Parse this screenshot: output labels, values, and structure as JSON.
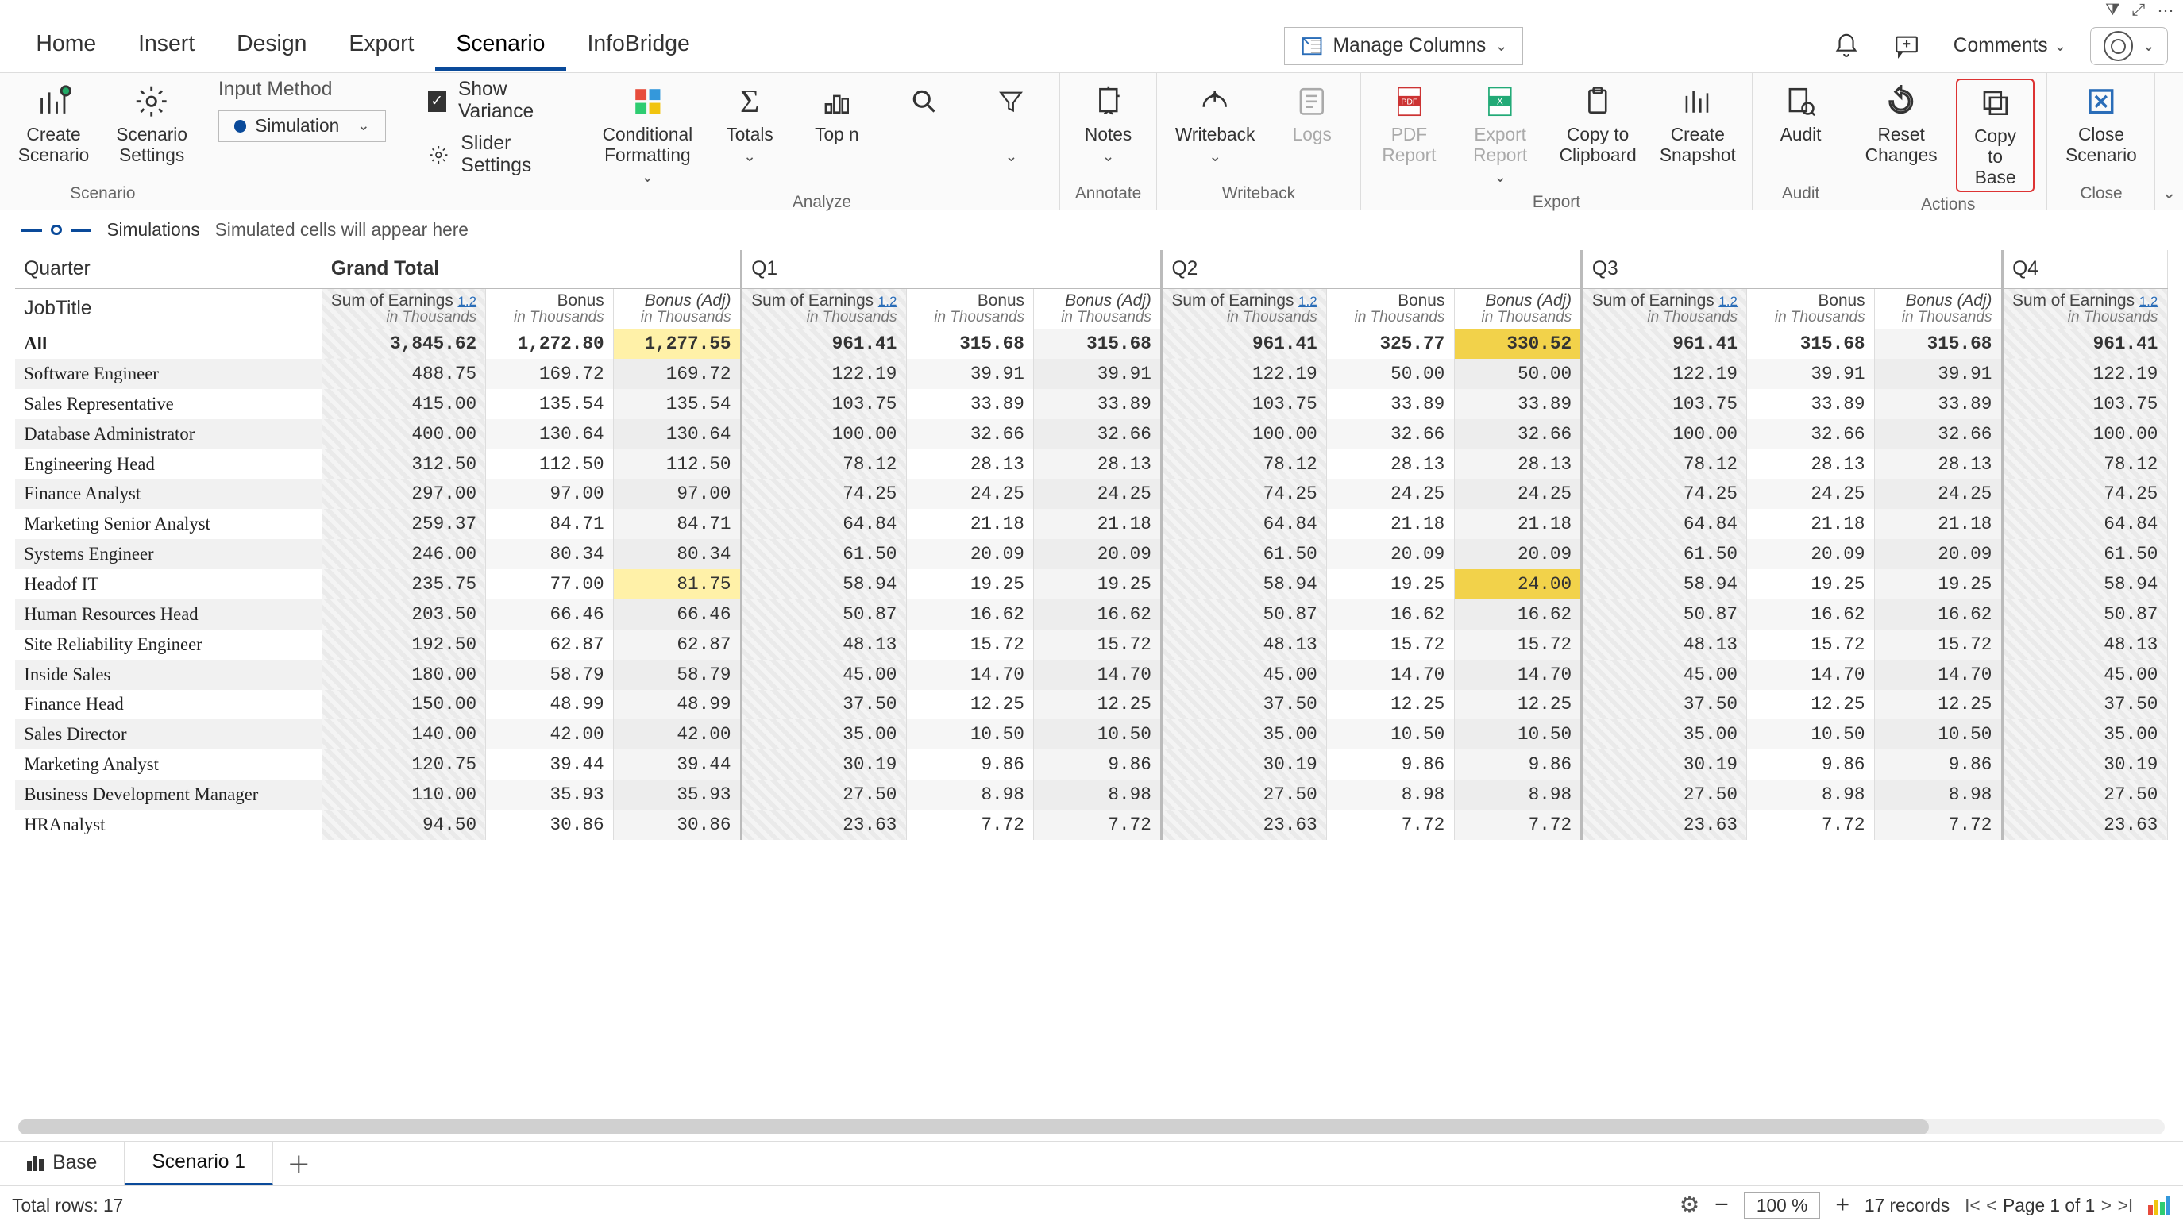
{
  "mini_icons": [
    "filter",
    "expand",
    "more"
  ],
  "tabs": [
    "Home",
    "Insert",
    "Design",
    "Export",
    "Scenario",
    "InfoBridge"
  ],
  "active_tab": "Scenario",
  "manage_columns": "Manage Columns",
  "comments": "Comments",
  "ribbon": {
    "groups": [
      {
        "label": "Scenario",
        "big": [
          {
            "k": "create",
            "l1": "Create",
            "l2": "Scenario"
          },
          {
            "k": "settings",
            "l1": "Scenario",
            "l2": "Settings"
          }
        ]
      },
      {
        "label": "",
        "input_method": "Input Method",
        "simulation": "Simulation",
        "show_variance": "Show Variance",
        "slider": "Slider Settings"
      },
      {
        "label": "Analyze",
        "big": [
          {
            "k": "cond",
            "l1": "Conditional",
            "l2": "Formatting",
            "dd": true
          },
          {
            "k": "totals",
            "l1": "Totals",
            "dd": true
          },
          {
            "k": "topn",
            "l1": "Top n"
          },
          {
            "k": "search",
            "l1": ""
          },
          {
            "k": "filter",
            "l1": "",
            "dd": true
          }
        ]
      },
      {
        "label": "Annotate",
        "big": [
          {
            "k": "notes",
            "l1": "Notes",
            "dd": true
          }
        ]
      },
      {
        "label": "Writeback",
        "big": [
          {
            "k": "wb",
            "l1": "Writeback",
            "dd": true
          },
          {
            "k": "logs",
            "l1": "Logs",
            "disabled": true
          }
        ]
      },
      {
        "label": "Export",
        "big": [
          {
            "k": "pdf",
            "l1": "PDF",
            "l2": "Report",
            "disabled": true
          },
          {
            "k": "xls",
            "l1": "Export",
            "l2": "Report",
            "dd": true,
            "disabled": true
          },
          {
            "k": "clip",
            "l1": "Copy to",
            "l2": "Clipboard"
          },
          {
            "k": "snap",
            "l1": "Create",
            "l2": "Snapshot"
          }
        ]
      },
      {
        "label": "Audit",
        "big": [
          {
            "k": "audit",
            "l1": "Audit"
          }
        ]
      },
      {
        "label": "Actions",
        "big": [
          {
            "k": "reset",
            "l1": "Reset",
            "l2": "Changes"
          },
          {
            "k": "copybase",
            "l1": "Copy to",
            "l2": "Base",
            "hl": true
          }
        ]
      },
      {
        "label": "Close",
        "big": [
          {
            "k": "close",
            "l1": "Close",
            "l2": "Scenario"
          }
        ]
      }
    ]
  },
  "sim_strip": {
    "label": "Simulations",
    "hint": "Simulated cells will appear here"
  },
  "grid": {
    "quarter_label": "Quarter",
    "jobtitle_label": "JobTitle",
    "quarters": [
      "Grand Total",
      "Q1",
      "Q2",
      "Q3",
      "Q4"
    ],
    "col_templates": {
      "earn": {
        "main": "Sum of Earnings",
        "sub": "in Thousands",
        "hatched": true,
        "onetwo": true
      },
      "bonus": {
        "main": "Bonus",
        "sub": "in Thousands"
      },
      "adj": {
        "main": "Bonus (Adj)",
        "sub": "in Thousands",
        "italic": true,
        "adj": true
      }
    },
    "rows": [
      {
        "label": "All",
        "all": true,
        "vals": [
          [
            "3,845.62",
            "1,272.80",
            "1,277.55"
          ],
          [
            "961.41",
            "315.68",
            "315.68"
          ],
          [
            "961.41",
            "325.77",
            "330.52"
          ],
          [
            "961.41",
            "315.68",
            "315.68"
          ],
          [
            "961.41"
          ]
        ],
        "ylw": [
          [
            0,
            2
          ]
        ],
        "ylw2": [
          [
            2,
            2
          ]
        ]
      },
      {
        "label": "Software Engineer",
        "vals": [
          [
            "488.75",
            "169.72",
            "169.72"
          ],
          [
            "122.19",
            "39.91",
            "39.91"
          ],
          [
            "122.19",
            "50.00",
            "50.00"
          ],
          [
            "122.19",
            "39.91",
            "39.91"
          ],
          [
            "122.19"
          ]
        ]
      },
      {
        "label": "Sales Representative",
        "vals": [
          [
            "415.00",
            "135.54",
            "135.54"
          ],
          [
            "103.75",
            "33.89",
            "33.89"
          ],
          [
            "103.75",
            "33.89",
            "33.89"
          ],
          [
            "103.75",
            "33.89",
            "33.89"
          ],
          [
            "103.75"
          ]
        ]
      },
      {
        "label": "Database Administrator",
        "vals": [
          [
            "400.00",
            "130.64",
            "130.64"
          ],
          [
            "100.00",
            "32.66",
            "32.66"
          ],
          [
            "100.00",
            "32.66",
            "32.66"
          ],
          [
            "100.00",
            "32.66",
            "32.66"
          ],
          [
            "100.00"
          ]
        ]
      },
      {
        "label": "Engineering Head",
        "vals": [
          [
            "312.50",
            "112.50",
            "112.50"
          ],
          [
            "78.12",
            "28.13",
            "28.13"
          ],
          [
            "78.12",
            "28.13",
            "28.13"
          ],
          [
            "78.12",
            "28.13",
            "28.13"
          ],
          [
            "78.12"
          ]
        ]
      },
      {
        "label": "Finance Analyst",
        "vals": [
          [
            "297.00",
            "97.00",
            "97.00"
          ],
          [
            "74.25",
            "24.25",
            "24.25"
          ],
          [
            "74.25",
            "24.25",
            "24.25"
          ],
          [
            "74.25",
            "24.25",
            "24.25"
          ],
          [
            "74.25"
          ]
        ]
      },
      {
        "label": "Marketing Senior Analyst",
        "vals": [
          [
            "259.37",
            "84.71",
            "84.71"
          ],
          [
            "64.84",
            "21.18",
            "21.18"
          ],
          [
            "64.84",
            "21.18",
            "21.18"
          ],
          [
            "64.84",
            "21.18",
            "21.18"
          ],
          [
            "64.84"
          ]
        ]
      },
      {
        "label": "Systems Engineer",
        "vals": [
          [
            "246.00",
            "80.34",
            "80.34"
          ],
          [
            "61.50",
            "20.09",
            "20.09"
          ],
          [
            "61.50",
            "20.09",
            "20.09"
          ],
          [
            "61.50",
            "20.09",
            "20.09"
          ],
          [
            "61.50"
          ]
        ]
      },
      {
        "label": "Headof IT",
        "vals": [
          [
            "235.75",
            "77.00",
            "81.75"
          ],
          [
            "58.94",
            "19.25",
            "19.25"
          ],
          [
            "58.94",
            "19.25",
            "24.00"
          ],
          [
            "58.94",
            "19.25",
            "19.25"
          ],
          [
            "58.94"
          ]
        ],
        "ylw": [
          [
            0,
            2
          ]
        ],
        "ylw2": [
          [
            2,
            2
          ]
        ]
      },
      {
        "label": "Human Resources Head",
        "vals": [
          [
            "203.50",
            "66.46",
            "66.46"
          ],
          [
            "50.87",
            "16.62",
            "16.62"
          ],
          [
            "50.87",
            "16.62",
            "16.62"
          ],
          [
            "50.87",
            "16.62",
            "16.62"
          ],
          [
            "50.87"
          ]
        ]
      },
      {
        "label": "Site Reliability Engineer",
        "vals": [
          [
            "192.50",
            "62.87",
            "62.87"
          ],
          [
            "48.13",
            "15.72",
            "15.72"
          ],
          [
            "48.13",
            "15.72",
            "15.72"
          ],
          [
            "48.13",
            "15.72",
            "15.72"
          ],
          [
            "48.13"
          ]
        ]
      },
      {
        "label": "Inside Sales",
        "vals": [
          [
            "180.00",
            "58.79",
            "58.79"
          ],
          [
            "45.00",
            "14.70",
            "14.70"
          ],
          [
            "45.00",
            "14.70",
            "14.70"
          ],
          [
            "45.00",
            "14.70",
            "14.70"
          ],
          [
            "45.00"
          ]
        ]
      },
      {
        "label": "Finance Head",
        "vals": [
          [
            "150.00",
            "48.99",
            "48.99"
          ],
          [
            "37.50",
            "12.25",
            "12.25"
          ],
          [
            "37.50",
            "12.25",
            "12.25"
          ],
          [
            "37.50",
            "12.25",
            "12.25"
          ],
          [
            "37.50"
          ]
        ]
      },
      {
        "label": "Sales Director",
        "vals": [
          [
            "140.00",
            "42.00",
            "42.00"
          ],
          [
            "35.00",
            "10.50",
            "10.50"
          ],
          [
            "35.00",
            "10.50",
            "10.50"
          ],
          [
            "35.00",
            "10.50",
            "10.50"
          ],
          [
            "35.00"
          ]
        ]
      },
      {
        "label": "Marketing Analyst",
        "vals": [
          [
            "120.75",
            "39.44",
            "39.44"
          ],
          [
            "30.19",
            "9.86",
            "9.86"
          ],
          [
            "30.19",
            "9.86",
            "9.86"
          ],
          [
            "30.19",
            "9.86",
            "9.86"
          ],
          [
            "30.19"
          ]
        ]
      },
      {
        "label": "Business Development Manager",
        "vals": [
          [
            "110.00",
            "35.93",
            "35.93"
          ],
          [
            "27.50",
            "8.98",
            "8.98"
          ],
          [
            "27.50",
            "8.98",
            "8.98"
          ],
          [
            "27.50",
            "8.98",
            "8.98"
          ],
          [
            "27.50"
          ]
        ]
      },
      {
        "label": "HRAnalyst",
        "vals": [
          [
            "94.50",
            "30.86",
            "30.86"
          ],
          [
            "23.63",
            "7.72",
            "7.72"
          ],
          [
            "23.63",
            "7.72",
            "7.72"
          ],
          [
            "23.63",
            "7.72",
            "7.72"
          ],
          [
            "23.63"
          ]
        ]
      }
    ]
  },
  "sheets": {
    "base": "Base",
    "scenario": "Scenario 1"
  },
  "status": {
    "total": "Total rows: 17",
    "zoom": "100 %",
    "records": "17 records",
    "page": "Page 1 of 1"
  }
}
